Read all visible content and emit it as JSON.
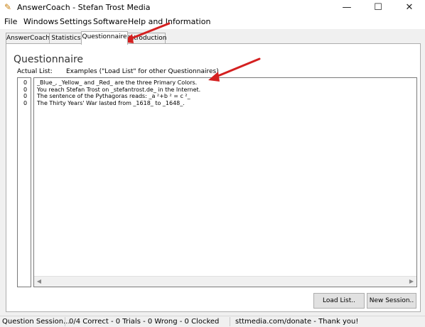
{
  "window": {
    "title": "AnswerCoach - Stefan Trost Media",
    "minimize_glyph": "—",
    "maximize_glyph": "☐",
    "close_glyph": "✕"
  },
  "menu": [
    "File",
    "Windows",
    "Settings",
    "Software",
    "Help and Information"
  ],
  "tabs": [
    {
      "label": "AnswerCoach",
      "active": false
    },
    {
      "label": "Statistics",
      "active": false
    },
    {
      "label": "Questionnaire",
      "active": true
    },
    {
      "label": "Introduction",
      "active": false
    }
  ],
  "panel": {
    "heading": "Questionnaire",
    "actual_list_label": "Actual List:",
    "examples_label": "Examples (\"Load List\" for other Questionnaires)",
    "counts": [
      "0",
      "0",
      "0",
      "0"
    ],
    "lines": [
      "_Blue_, _Yellow_ and _Red_ are the three Primary Colors.",
      "You reach Stefan Trost on _stefantrost.de_ in the Internet.",
      "The sentence of the Pythagoras reads: _a ²+b ² = c ²_",
      "The Thirty Years' War lasted from _1618_ to _1648_."
    ],
    "load_button": "Load List..",
    "new_session_button": "New Session.."
  },
  "status": {
    "session": "Question Session...",
    "stats": "0/4 Correct - 0 Trials - 0 Wrong - 0 Clocked",
    "donate": "sttmedia.com/donate - Thank you!"
  },
  "colors": {
    "annotation_arrow": "#d42020"
  }
}
